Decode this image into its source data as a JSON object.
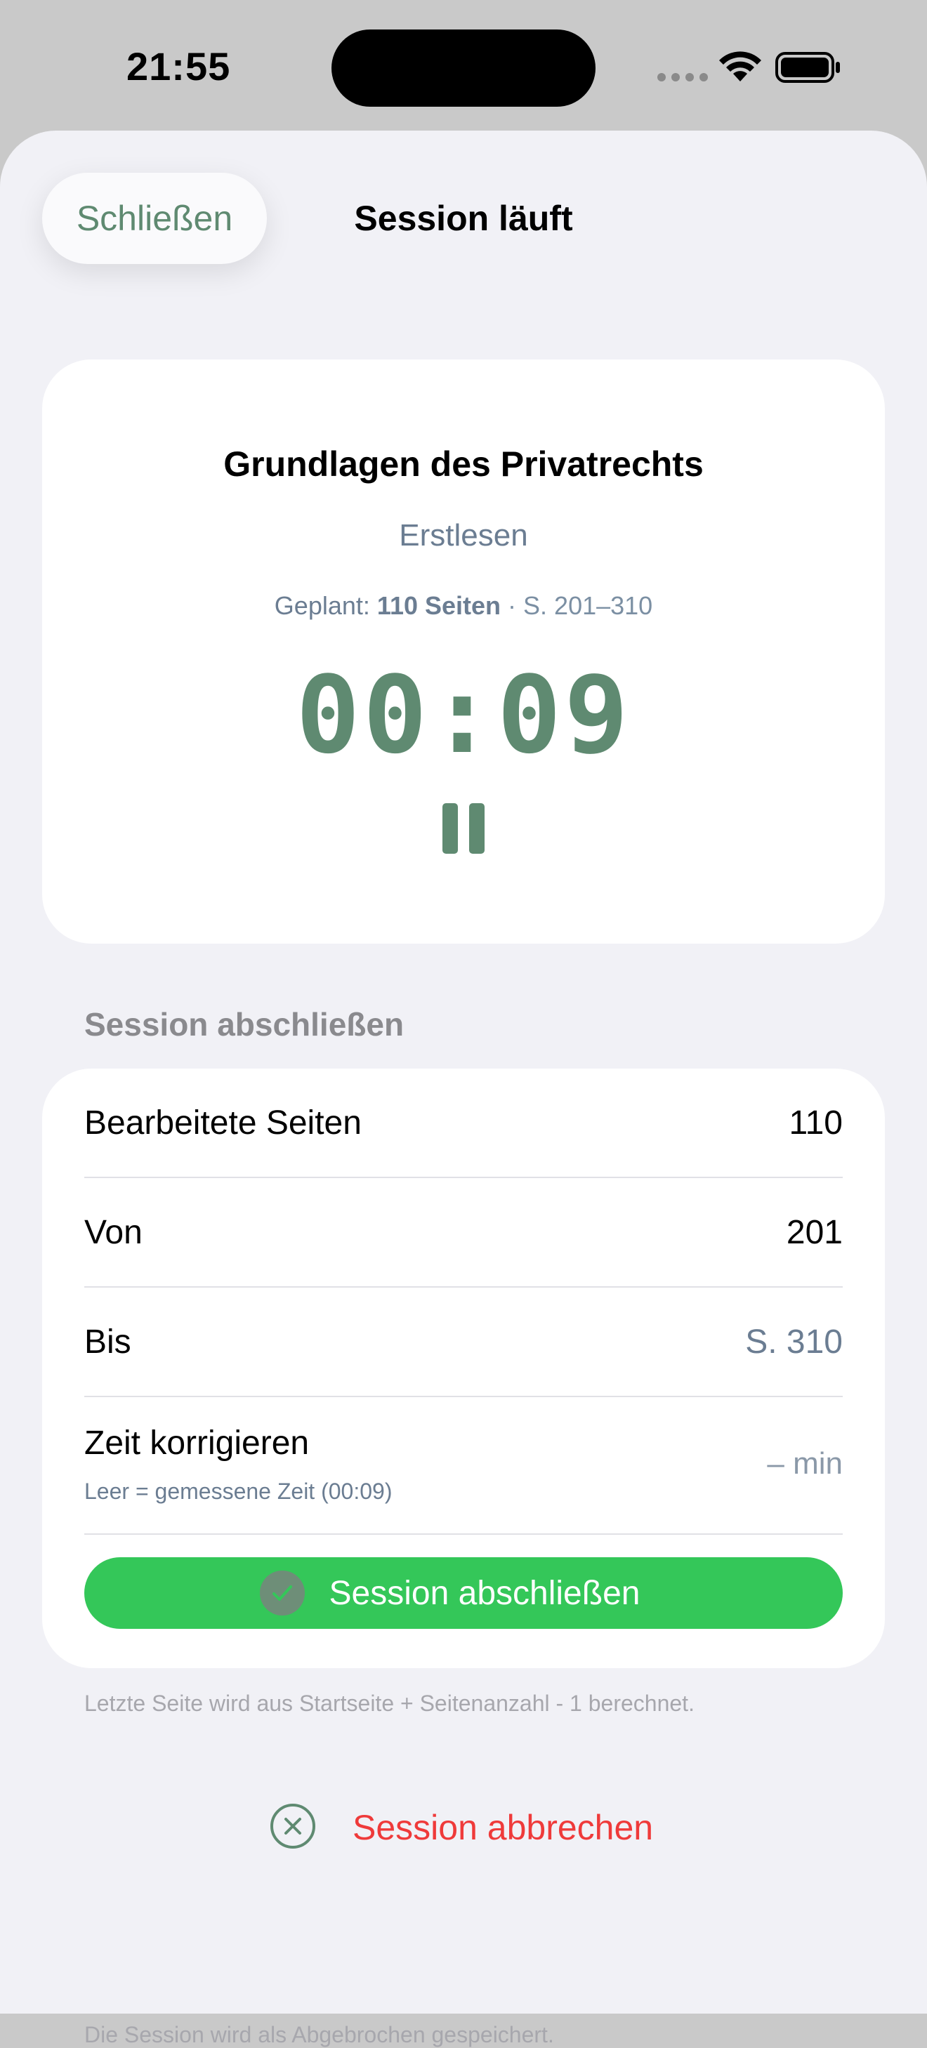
{
  "status_bar": {
    "time": "21:55"
  },
  "header": {
    "close_label": "Schließen",
    "title": "Session läuft"
  },
  "timer_card": {
    "book_title": "Grundlagen des Privatrechts",
    "mode": "Erstlesen",
    "plan_prefix": "Geplant:",
    "plan_pages": "110 Seiten",
    "plan_range": "· S. 201–310",
    "timer": "00:09"
  },
  "finish_section": {
    "header": "Session abschließen",
    "rows": [
      {
        "label": "Bearbeitete Seiten",
        "value": "110"
      },
      {
        "label": "Von",
        "value": "201"
      },
      {
        "label": "Bis",
        "value": "S. 310"
      }
    ],
    "time_row": {
      "label": "Zeit korrigieren",
      "sub": "Leer = gemessene Zeit (00:09)",
      "placeholder": "– min"
    },
    "button_label": "Session abschließen",
    "footnote": "Letzte Seite wird aus Startseite + Seitenanzahl - 1 berechnet."
  },
  "cancel": {
    "label": "Session abbrechen",
    "footnote": "Die Session wird als Abgebrochen gespeichert."
  },
  "colors": {
    "accent": "#5f8a71",
    "success": "#34c759",
    "destructive": "#ef3a3a",
    "background": "#f1f1f6"
  },
  "icons": {
    "pause": "pause-icon",
    "check": "checkmark-circle-icon",
    "cancel": "xmark-circle-icon",
    "wifi": "wifi-icon",
    "battery": "battery-icon"
  }
}
